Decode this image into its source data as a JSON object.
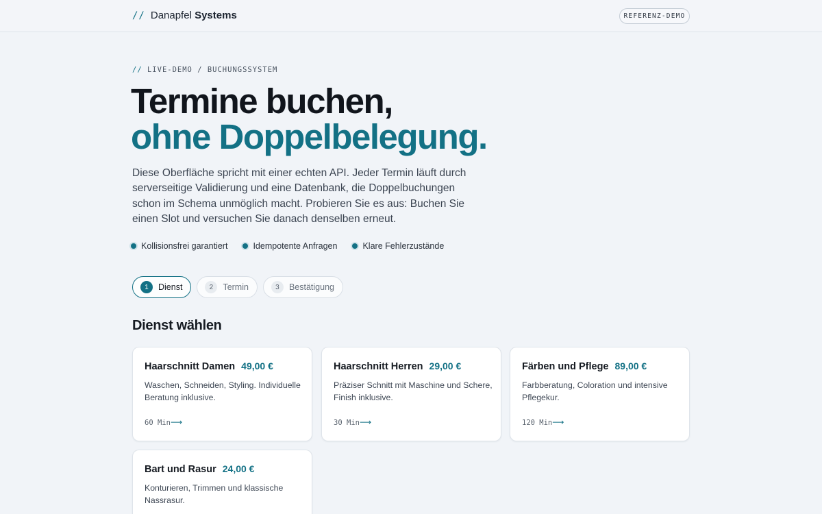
{
  "header": {
    "brand_slash": "//",
    "brand_name": "Danapfel",
    "brand_name_bold": "Systems",
    "demo_badge": "REFERENZ-DEMO"
  },
  "hero": {
    "breadcrumb_slash": "//",
    "breadcrumb": "LIVE-DEMO / BUCHUNGSSYSTEM",
    "title_line1": "Termine buchen,",
    "title_line2": "ohne Doppelbelegung.",
    "lead": "Diese Oberfläche spricht mit einer echten API. Jeder Termin läuft durch serverseitige Validierung und eine Datenbank, die Doppelbuchungen schon im Schema unmöglich macht. Probieren Sie es aus: Buchen Sie einen Slot und versuchen Sie danach denselben erneut.",
    "features": [
      "Kollisionsfrei garantiert",
      "Idempotente Anfragen",
      "Klare Fehlerzustände"
    ]
  },
  "steps": [
    {
      "num": "1",
      "label": "Dienst",
      "active": true
    },
    {
      "num": "2",
      "label": "Termin",
      "active": false
    },
    {
      "num": "3",
      "label": "Bestätigung",
      "active": false
    }
  ],
  "services": {
    "title": "Dienst wählen",
    "items": [
      {
        "name": "Haarschnitt Damen",
        "price": "49,00 €",
        "desc": "Waschen, Schneiden, Styling. Individuelle Beratung inklusive.",
        "duration": "60 Min",
        "arrow": "⟶"
      },
      {
        "name": "Haarschnitt Herren",
        "price": "29,00 €",
        "desc": "Präziser Schnitt mit Maschine und Schere, Finish inklusive.",
        "duration": "30 Min",
        "arrow": "⟶"
      },
      {
        "name": "Färben und Pflege",
        "price": "89,00 €",
        "desc": "Farbberatung, Coloration und intensive Pflegekur.",
        "duration": "120 Min",
        "arrow": "⟶"
      },
      {
        "name": "Bart und Rasur",
        "price": "24,00 €",
        "desc": "Konturieren, Trimmen und klassische Nassrasur.",
        "duration": "",
        "arrow": ""
      }
    ]
  },
  "colors": {
    "accent": "#137185",
    "background": "#f1f4f8",
    "text": "#161b22"
  }
}
